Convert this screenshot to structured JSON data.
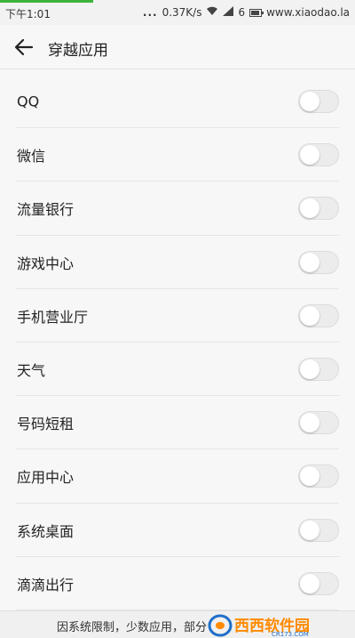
{
  "status_bar": {
    "time": "下午1:01",
    "dots": "...",
    "speed": "0.37K/s",
    "signal_label": "6",
    "site": "www.xiaodao.la"
  },
  "header": {
    "title": "穿越应用"
  },
  "apps": [
    {
      "label": "QQ",
      "enabled": false
    },
    {
      "label": "微信",
      "enabled": false
    },
    {
      "label": "流量银行",
      "enabled": false
    },
    {
      "label": "游戏中心",
      "enabled": false
    },
    {
      "label": "手机营业厅",
      "enabled": false
    },
    {
      "label": "天气",
      "enabled": false
    },
    {
      "label": "号码短租",
      "enabled": false
    },
    {
      "label": "应用中心",
      "enabled": false
    },
    {
      "label": "系统桌面",
      "enabled": false
    },
    {
      "label": "滴滴出行",
      "enabled": false
    }
  ],
  "footer": {
    "notice": "因系统限制，少数应用，部分"
  },
  "logo": {
    "name": "西西软件园",
    "domain": "CR173.COM"
  },
  "colors": {
    "accent_green": "#3cb43c",
    "toggle_off": "#ececec",
    "logo_blue": "#1f6fc9",
    "logo_orange": "#ff8a00"
  }
}
